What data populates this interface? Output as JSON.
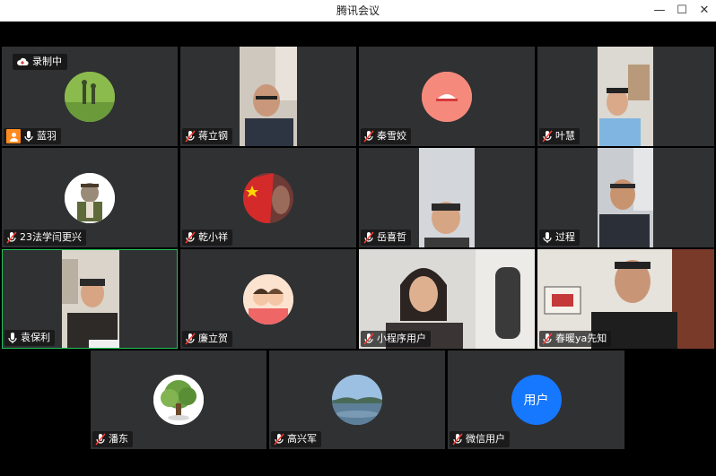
{
  "window": {
    "title": "腾讯会议",
    "minimize": "—",
    "maximize": "☐",
    "close": "✕"
  },
  "recording": {
    "label": "录制中"
  },
  "participants": [
    {
      "name": "蓝羽",
      "host": true
    },
    {
      "name": "蒋立钢"
    },
    {
      "name": "秦雪姣"
    },
    {
      "name": "叶慧"
    },
    {
      "name": "23法学闫更兴"
    },
    {
      "name": "乾小祥"
    },
    {
      "name": "岳喜哲"
    },
    {
      "name": "过程"
    },
    {
      "name": "袁保利",
      "active": true
    },
    {
      "name": "廉立贺"
    },
    {
      "name": "小程序用户"
    },
    {
      "name": "春暖ya先知"
    },
    {
      "name": "潘东"
    },
    {
      "name": "高兴军"
    },
    {
      "name": "微信用户",
      "avatar_text": "用户"
    }
  ],
  "colors": {
    "tile_bg": "#303133",
    "active_border": "#21c25a",
    "host_badge": "#ff8a1f",
    "user_avatar": "#1677ff"
  }
}
